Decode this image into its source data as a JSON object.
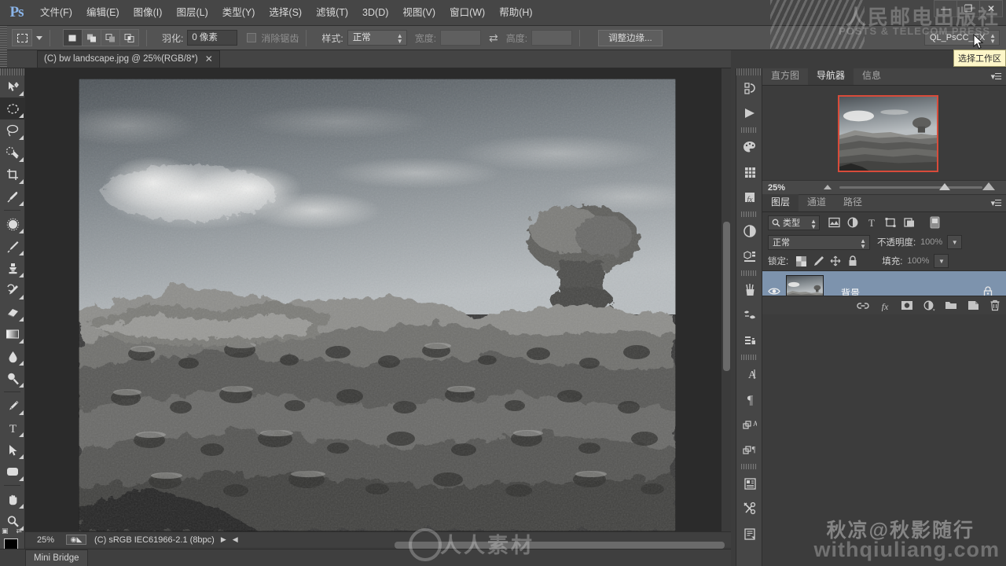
{
  "app": {
    "logo": "Ps",
    "workspace": "QL_PsCC_EX",
    "tooltip": "选择工作区"
  },
  "menubar": {
    "items": [
      {
        "label": "文件(F)"
      },
      {
        "label": "编辑(E)"
      },
      {
        "label": "图像(I)"
      },
      {
        "label": "图层(L)"
      },
      {
        "label": "类型(Y)"
      },
      {
        "label": "选择(S)"
      },
      {
        "label": "滤镜(T)"
      },
      {
        "label": "3D(D)"
      },
      {
        "label": "视图(V)"
      },
      {
        "label": "窗口(W)"
      },
      {
        "label": "帮助(H)"
      }
    ],
    "window_controls": {
      "minimize": "—",
      "maximize": "❐",
      "close": "✕"
    }
  },
  "options_bar": {
    "tool_icon": "rectangular-marquee-icon",
    "selection_modes": [
      "new-selection",
      "add-to-selection",
      "subtract-from-selection",
      "intersect-with-selection"
    ],
    "feather_label": "羽化:",
    "feather_value": "0 像素",
    "antialias_label": "消除锯齿",
    "antialias_checked": false,
    "style_label": "样式:",
    "style_value": "正常",
    "width_label": "宽度:",
    "width_value": "",
    "swap_icon": "swap-dimensions-icon",
    "height_label": "高度:",
    "height_value": "",
    "refine_edge_label": "调整边缘..."
  },
  "document_tab": {
    "title": "(C) bw landscape.jpg @ 25%(RGB/8*)",
    "close": "✕"
  },
  "toolbar": {
    "tools": [
      {
        "name": "move-tool",
        "glyph": "move"
      },
      {
        "name": "rectangular-marquee-tool",
        "glyph": "marquee"
      },
      {
        "name": "lasso-tool",
        "glyph": "lasso"
      },
      {
        "name": "quick-selection-tool",
        "glyph": "quickselect"
      },
      {
        "name": "crop-tool",
        "glyph": "crop"
      },
      {
        "name": "eyedropper-tool",
        "glyph": "eyedropper"
      },
      {
        "name": "spot-healing-brush-tool",
        "glyph": "healing"
      },
      {
        "name": "brush-tool",
        "glyph": "brush"
      },
      {
        "name": "clone-stamp-tool",
        "glyph": "stamp"
      },
      {
        "name": "history-brush-tool",
        "glyph": "historybrush"
      },
      {
        "name": "eraser-tool",
        "glyph": "eraser"
      },
      {
        "name": "gradient-tool",
        "glyph": "gradient"
      },
      {
        "name": "blur-tool",
        "glyph": "blur"
      },
      {
        "name": "dodge-tool",
        "glyph": "dodge"
      },
      {
        "name": "pen-tool",
        "glyph": "pen"
      },
      {
        "name": "horizontal-type-tool",
        "glyph": "type"
      },
      {
        "name": "path-selection-tool",
        "glyph": "pathselect"
      },
      {
        "name": "rectangle-tool",
        "glyph": "shape"
      },
      {
        "name": "hand-tool",
        "glyph": "hand"
      },
      {
        "name": "zoom-tool",
        "glyph": "zoom"
      }
    ],
    "foreground_color": "#000000",
    "background_color": "#ffffff"
  },
  "status_bar": {
    "zoom": "25%",
    "profile_icon": "color-profile-icon",
    "doc_info": "(C) sRGB IEC61966-2.1 (8bpc)",
    "next_arrow": "▶",
    "prev_arrow": "◀"
  },
  "mini_bridge": {
    "tab_label": "Mini Bridge"
  },
  "icon_dock": {
    "icons": [
      {
        "name": "mini-bridge-icon"
      },
      {
        "name": "timeline-play-icon"
      },
      {
        "name": "color-palette-icon"
      },
      {
        "name": "swatches-grid-icon"
      },
      {
        "name": "styles-fx-icon"
      },
      {
        "name": "adjustments-icon"
      },
      {
        "name": "3d-panel-icon"
      },
      {
        "name": "brush-panel-icon"
      },
      {
        "name": "brush-presets-icon"
      },
      {
        "name": "clone-source-icon"
      },
      {
        "name": "character-panel-icon"
      },
      {
        "name": "paragraph-panel-icon"
      },
      {
        "name": "character-styles-icon"
      },
      {
        "name": "paragraph-styles-icon"
      },
      {
        "name": "notes-panel-icon"
      },
      {
        "name": "tool-presets-icon"
      },
      {
        "name": "actions-panel-icon"
      }
    ]
  },
  "navigator_panel": {
    "tabs": [
      {
        "label": "直方图",
        "active": false
      },
      {
        "label": "导航器",
        "active": true
      },
      {
        "label": "信息",
        "active": false
      }
    ],
    "zoom_value": "25%",
    "view_box_color": "#d84b3a",
    "menu_icon": "panel-menu-icon"
  },
  "layers_panel": {
    "tabs": [
      {
        "label": "图层",
        "active": true
      },
      {
        "label": "通道",
        "active": false
      },
      {
        "label": "路径",
        "active": false
      }
    ],
    "filter_label": "类型",
    "filter_icons": [
      "filter-pixel-icon",
      "filter-adjustment-icon",
      "filter-type-icon",
      "filter-shape-icon",
      "filter-smart-icon"
    ],
    "filter_toggle": "filter-enable-toggle",
    "blend_mode": "正常",
    "opacity_label": "不透明度:",
    "opacity_value": "100%",
    "lock_label": "锁定:",
    "lock_icons": [
      "lock-transparent-icon",
      "lock-image-icon",
      "lock-position-icon",
      "lock-all-icon"
    ],
    "fill_label": "填充:",
    "fill_value": "100%",
    "layers": [
      {
        "name": "背景",
        "visible": true,
        "locked": true,
        "selected": true,
        "thumbnail": "layer-thumbnail"
      }
    ],
    "bottom_icons": [
      {
        "name": "link-layers-icon"
      },
      {
        "name": "layer-style-fx-icon"
      },
      {
        "name": "add-layer-mask-icon"
      },
      {
        "name": "new-adjustment-layer-icon"
      },
      {
        "name": "new-group-icon"
      },
      {
        "name": "new-layer-icon"
      },
      {
        "name": "delete-layer-icon"
      }
    ]
  },
  "watermarks": {
    "top_right_cn": "人民邮电出版社",
    "top_right_en": "POSTS & TELECOM PRESS",
    "bottom_right_cn": "秋凉@秋影随行",
    "bottom_right_url": "withqiuliang.com",
    "bottom_center": "人人素材"
  }
}
